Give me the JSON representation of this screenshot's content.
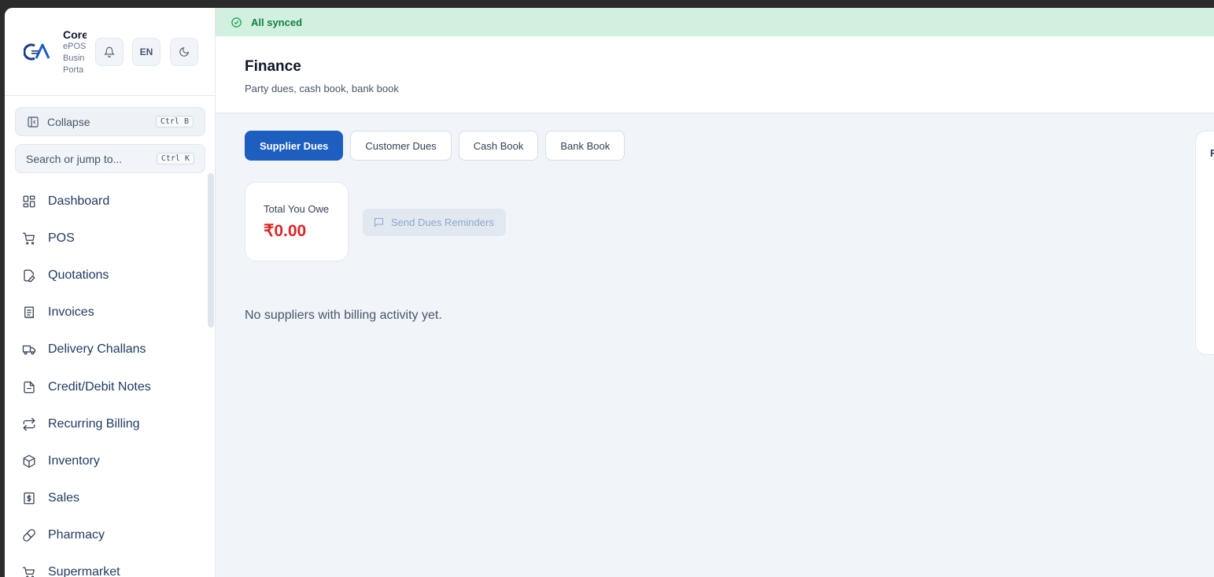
{
  "brand": {
    "name": "Core",
    "sub_lines": [
      "ePOS",
      "Busin",
      "Porta"
    ]
  },
  "header_buttons": {
    "language": "EN"
  },
  "sidebar": {
    "collapse_label": "Collapse",
    "collapse_shortcut": "Ctrl B",
    "search_placeholder": "Search or jump to...",
    "search_shortcut": "Ctrl K",
    "items": [
      {
        "label": "Dashboard",
        "icon": "dashboard-icon"
      },
      {
        "label": "POS",
        "icon": "cart-icon"
      },
      {
        "label": "Quotations",
        "icon": "edit-document-icon"
      },
      {
        "label": "Invoices",
        "icon": "receipt-icon"
      },
      {
        "label": "Delivery Challans",
        "icon": "truck-icon"
      },
      {
        "label": "Credit/Debit Notes",
        "icon": "document-icon"
      },
      {
        "label": "Recurring Billing",
        "icon": "repeat-icon"
      },
      {
        "label": "Inventory",
        "icon": "box-icon"
      },
      {
        "label": "Sales",
        "icon": "dollar-receipt-icon"
      },
      {
        "label": "Pharmacy",
        "icon": "pill-icon"
      },
      {
        "label": "Supermarket",
        "icon": "basket-icon"
      }
    ]
  },
  "sync": {
    "status": "All synced"
  },
  "page": {
    "title": "Finance",
    "subtitle": "Party dues, cash book, bank book"
  },
  "tabs": [
    {
      "label": "Supplier Dues",
      "active": true
    },
    {
      "label": "Customer Dues",
      "active": false
    },
    {
      "label": "Cash Book",
      "active": false
    },
    {
      "label": "Bank Book",
      "active": false
    }
  ],
  "summary": {
    "label": "Total You Owe",
    "value": "₹0.00"
  },
  "actions": {
    "send_reminders": "Send Dues Reminders"
  },
  "empty_state": "No suppliers with billing activity yet.",
  "side_panel": {
    "heading_initial": "F"
  },
  "colors": {
    "accent": "#1d5fbf",
    "sync_bg": "#d1f0e0",
    "sync_text": "#15803d",
    "amount_red": "#dc2626"
  }
}
